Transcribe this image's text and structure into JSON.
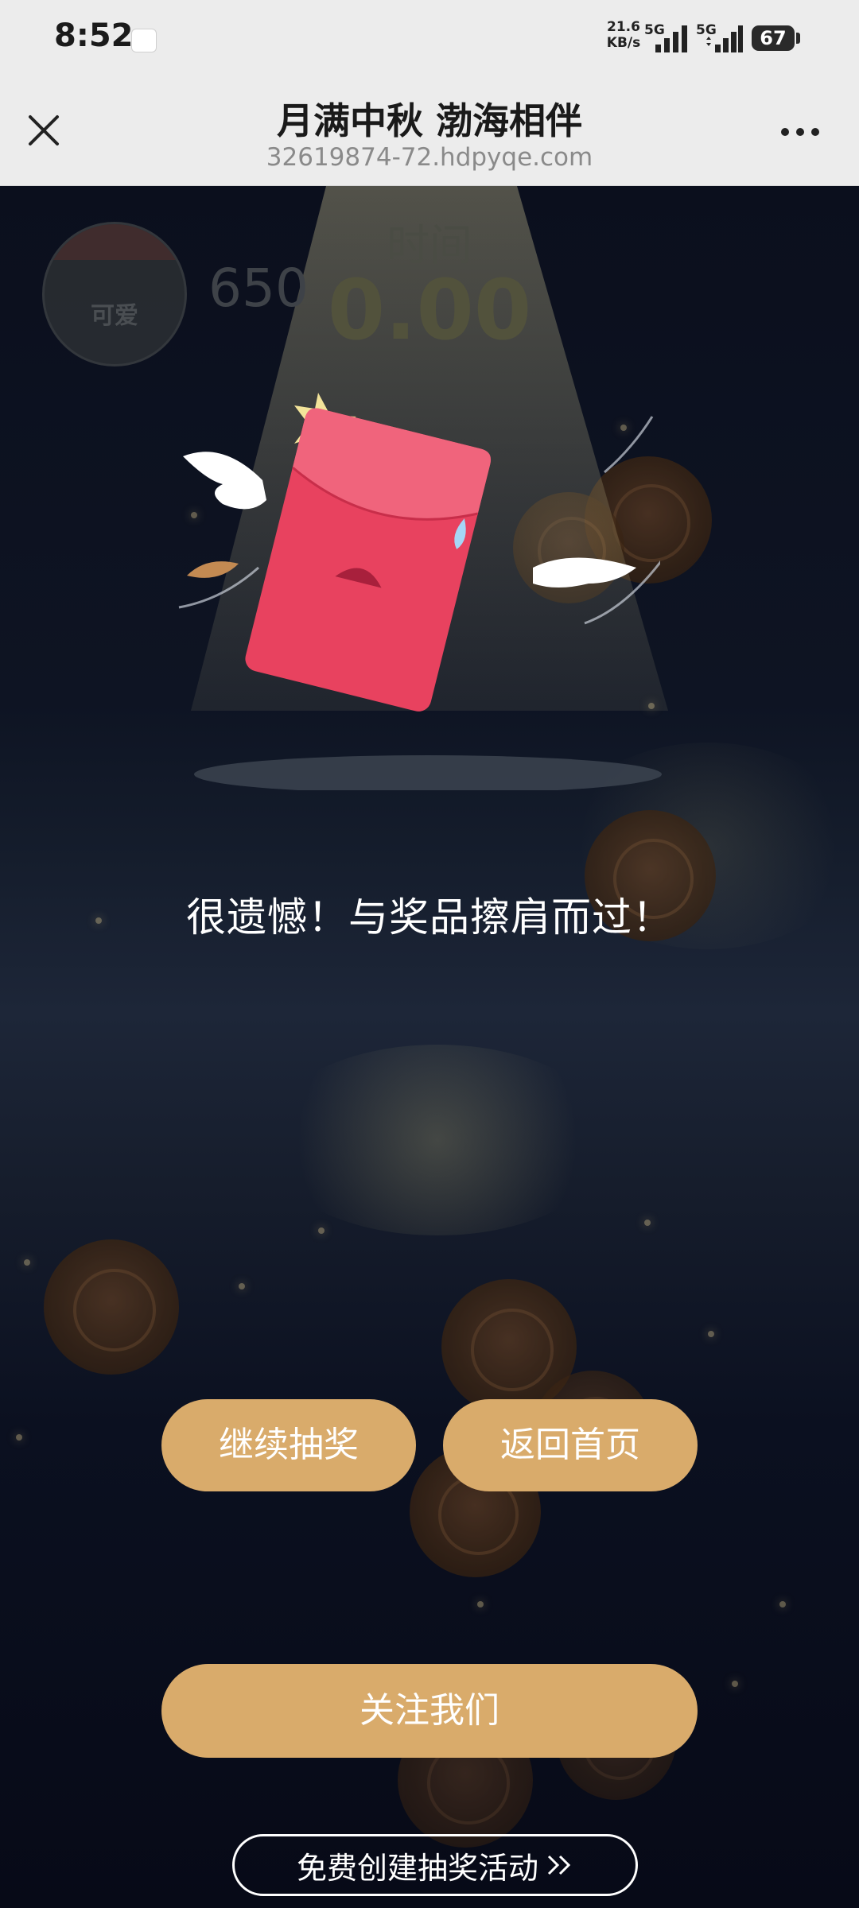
{
  "status_bar": {
    "time": "8:52",
    "net_speed_value": "21.6",
    "net_speed_unit": "KB/s",
    "signal1_label": "5G",
    "signal2_label": "5G",
    "battery": "67"
  },
  "header": {
    "title": "月满中秋 渤海相伴",
    "url": "32619874-72.hdpyqe.com"
  },
  "hud": {
    "avatar_text": "可爱",
    "score": "650",
    "time_label": "时间",
    "time_value": "0.00"
  },
  "result": {
    "message": "很遗憾！与奖品擦肩而过！"
  },
  "buttons": {
    "continue_label": "继续抽奖",
    "home_label": "返回首页",
    "follow_label": "关注我们",
    "create_label": "免费创建抽奖活动"
  },
  "colors": {
    "accent": "#d9ab6b",
    "envelope": "#e6405f",
    "background": "#0e1423"
  }
}
